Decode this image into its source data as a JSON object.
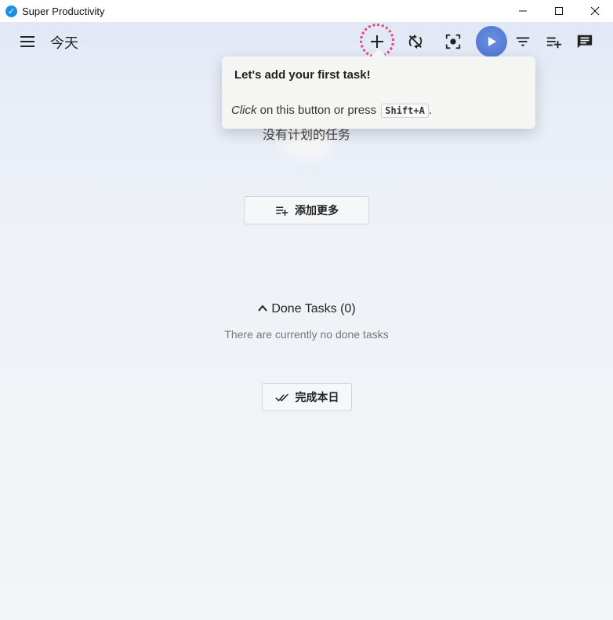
{
  "window": {
    "title": "Super Productivity",
    "controls": {
      "minimize": "minimize",
      "maximize": "maximize",
      "close": "close"
    }
  },
  "header": {
    "page_title": "今天",
    "icons": [
      "menu-icon",
      "add-icon",
      "sync-icon",
      "focus-icon",
      "play-icon",
      "filter-icon",
      "add-to-list-icon",
      "chat-icon"
    ]
  },
  "tour": {
    "title": "Let's add your first task!",
    "body_click": "Click",
    "body_rest": " on this button or press ",
    "shortcut": "Shift+A",
    "body_end": "."
  },
  "main": {
    "empty_text": "没有计划的任务",
    "add_more_label": "添加更多",
    "done_tasks_label": "Done Tasks (0)",
    "done_empty_text": "There are currently no done tasks",
    "finish_day_label": "完成本日"
  },
  "colors": {
    "accent": "#5a7fd8",
    "highlight": "#e8457f"
  }
}
